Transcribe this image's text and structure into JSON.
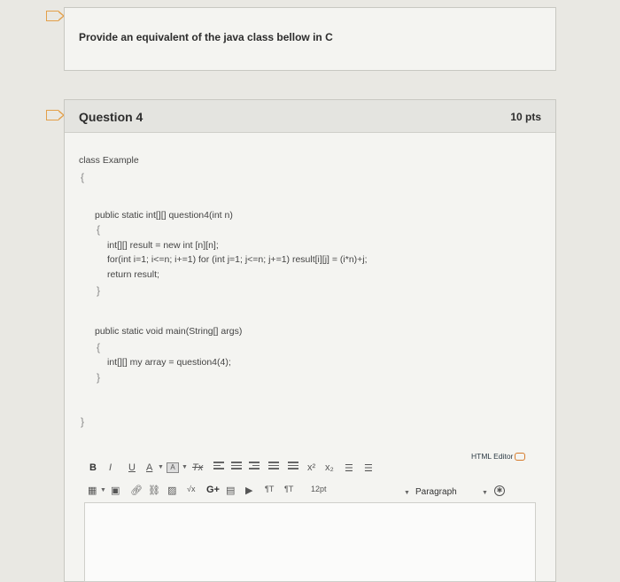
{
  "question3": {
    "prompt": "Provide an equivalent of the java class bellow in C"
  },
  "question4": {
    "title": "Question 4",
    "points": "10 pts",
    "code": {
      "line1": "class Example",
      "brace_open": "{",
      "line2": "public static int[][] question4(int n)",
      "brace_open2": "{",
      "line3": "int[][] result = new int [n][n];",
      "line4": "for(int i=1; i<=n; i+=1) for (int j=1; j<=n; j+=1) result[i][j] = (i*n)+j;",
      "line5": "return result;",
      "brace_close2": "}",
      "line6": "public static void main(String[] args)",
      "brace_open3": "{",
      "line7": "int[][] my array = question4(4);",
      "brace_close3": "}",
      "brace_close": "}"
    }
  },
  "editor": {
    "html_editor_label": "HTML Editor",
    "font_size": "12pt",
    "paragraph": "Paragraph",
    "toolbar": {
      "bold": "B",
      "italic": "I",
      "underline": "U",
      "font_color": "A",
      "bg_color": "A",
      "clear_format": "Tx",
      "superscript": "x²",
      "subscript": "x₂",
      "math": "√x",
      "pilcrow": "¶T",
      "rtl": "¶T"
    }
  },
  "colors": {
    "flag": "#e3a04a",
    "background": "#e9e8e3",
    "card": "#f4f4f1"
  }
}
